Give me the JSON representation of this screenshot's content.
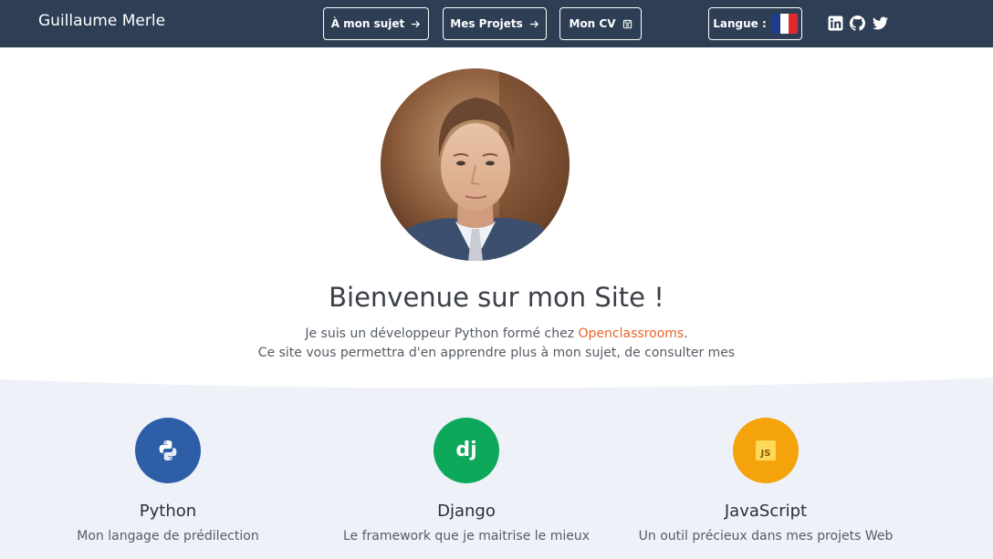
{
  "header": {
    "brand": "Guillaume Merle",
    "nav": [
      {
        "label": "À mon sujet",
        "icon": "arrow-right-icon"
      },
      {
        "label": "Mes Projets",
        "icon": "arrow-right-icon"
      },
      {
        "label": "Mon CV",
        "icon": "save-icon"
      }
    ],
    "language": {
      "label": "Langue :",
      "flag": "france-flag-icon"
    },
    "social": [
      "linkedin-icon",
      "github-icon",
      "twitter-icon"
    ]
  },
  "hero": {
    "avatar": "profile-photo",
    "title": "Bienvenue sur mon Site !",
    "line1_before": "Je suis un développeur Python formé chez ",
    "line1_link": "Openclassrooms",
    "line1_after": ".",
    "line2": "Ce site vous permettra d'en apprendre plus à mon sujet, de consulter mes"
  },
  "skills": [
    {
      "title": "Python",
      "desc": "Mon langage de prédilection",
      "icon": "python-icon",
      "color": "#2f5ea8"
    },
    {
      "title": "Django",
      "desc": "Le framework que je maitrise le mieux",
      "icon": "django-icon",
      "color": "#0da85a"
    },
    {
      "title": "JavaScript",
      "desc": "Un outil précieux dans mes projets Web",
      "icon": "javascript-icon",
      "color": "#f5a30a"
    }
  ],
  "colors": {
    "navbar": "#2e3e55",
    "band": "#eef2f8",
    "link": "#e8642c"
  }
}
